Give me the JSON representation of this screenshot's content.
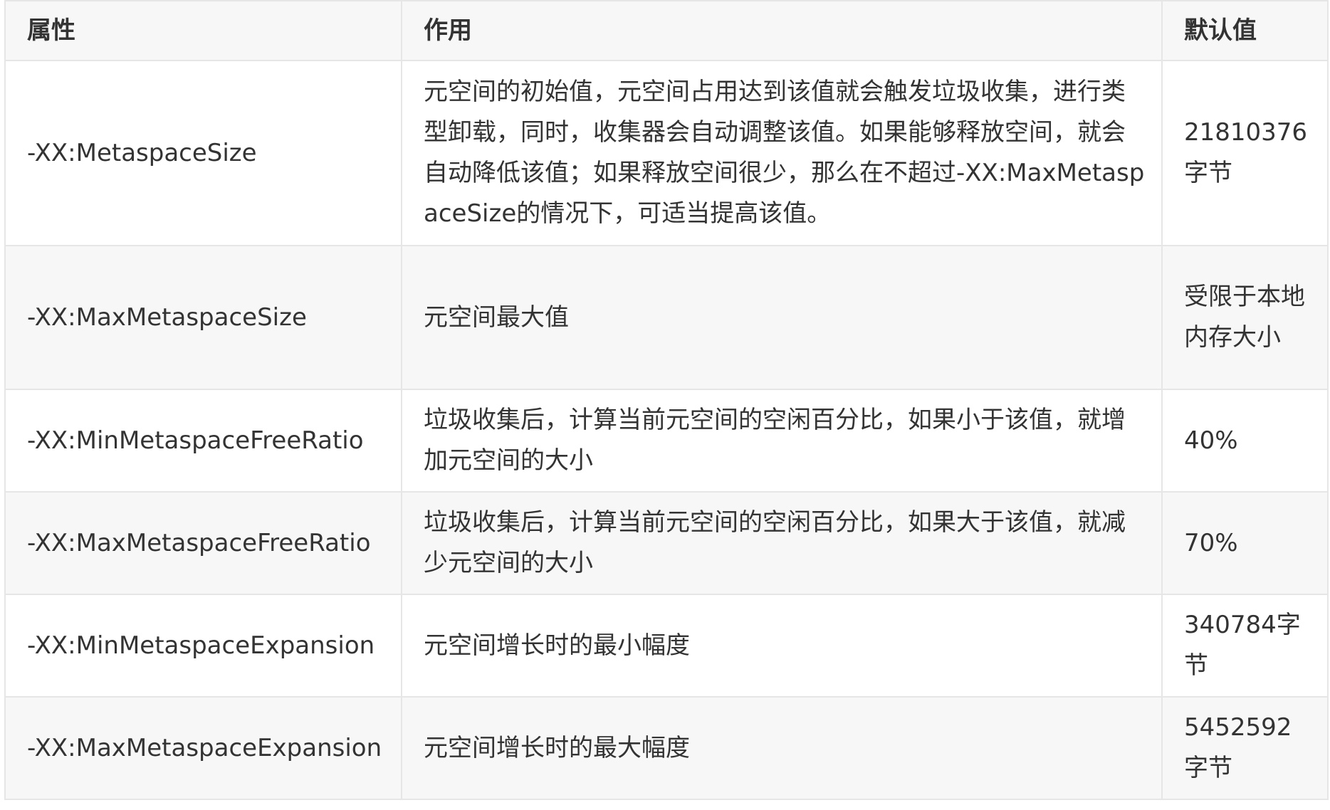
{
  "table": {
    "headers": [
      "属性",
      "作用",
      "默认值"
    ],
    "rows": [
      {
        "property": "-XX:MetaspaceSize",
        "effect": "元空间的初始值，元空间占用达到该值就会触发垃圾收集，进行类型卸载，同时，收集器会自动调整该值。如果能够释放空间，就会自动降低该值；如果释放空间很少，那么在不超过-XX:MaxMetaspaceSize的情况下，可适当提高该值。",
        "default": "21810376字节"
      },
      {
        "property": "-XX:MaxMetaspaceSize",
        "effect": "元空间最大值",
        "default": "受限于本地内存大小"
      },
      {
        "property": "-XX:MinMetaspaceFreeRatio",
        "effect": "垃圾收集后，计算当前元空间的空闲百分比，如果小于该值，就增加元空间的大小",
        "default": "40%"
      },
      {
        "property": "-XX:MaxMetaspaceFreeRatio",
        "effect": "垃圾收集后，计算当前元空间的空闲百分比，如果大于该值，就减少元空间的大小",
        "default": "70%"
      },
      {
        "property": "-XX:MinMetaspaceExpansion",
        "effect": "元空间增长时的最小幅度",
        "default": "340784字节"
      },
      {
        "property": "-XX:MaxMetaspaceExpansion",
        "effect": "元空间增长时的最大幅度",
        "default": "5452592字节"
      }
    ]
  }
}
